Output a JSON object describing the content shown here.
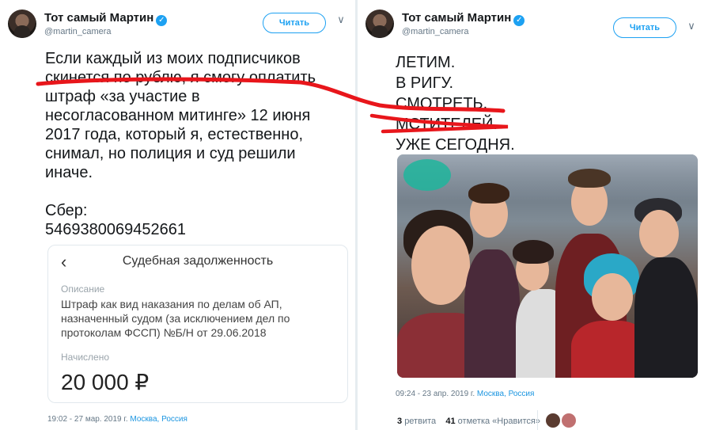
{
  "left_tweet": {
    "author_name": "Тот самый Мартин",
    "verified_mark": "✓",
    "handle": "@martin_camera",
    "follow_label": "Читать",
    "chevron": "∨",
    "text_lines": [
      "Если каждый из моих подписчиков",
      "скинется по рублю, я смогу оплатить",
      "штраф «за участие в",
      "несогласованном митинге» 12 июня",
      "2017 года, который я, естественно,",
      "снимал, но полиция и суд решили",
      "иначе."
    ],
    "bank_label": "Сбер:",
    "card_number": "5469380069452661",
    "embedded_card": {
      "back_glyph": "‹",
      "title": "Судебная задолженность",
      "description_label": "Описание",
      "description_lines": [
        "Штраф как вид наказания по делам об АП,",
        "назначенный судом (за исключением дел по",
        "протоколам ФССП) №Б/Н от 29.06.2018"
      ],
      "amount_label": "Начислено",
      "amount": "20 000 ₽"
    },
    "timestamp": "19:02 - 27 мар. 2019 г.",
    "location": "Москва, Россия"
  },
  "right_tweet": {
    "author_name": "Тот самый Мартин",
    "verified_mark": "✓",
    "handle": "@martin_camera",
    "follow_label": "Читать",
    "chevron": "∨",
    "text_lines": [
      "ЛЕТИМ.",
      "В РИГУ.",
      "СМОТРЕТЬ.",
      "МСТИТЕЛЕЙ.",
      "УЖЕ СЕГОДНЯ."
    ],
    "timestamp": "09:24 - 23 апр. 2019 г.",
    "location": "Москва, Россия",
    "retweets_count": "3",
    "retweets_label": "ретвита",
    "likes_count": "41",
    "likes_label": "отметка «Нравится»"
  },
  "icons": [
    "verified-badge-icon",
    "chevron-down-icon",
    "back-arrow-icon"
  ],
  "colors": {
    "accent_blue": "#1da1f2",
    "strike_red": "#e8161b",
    "meta_gray": "#657786"
  }
}
